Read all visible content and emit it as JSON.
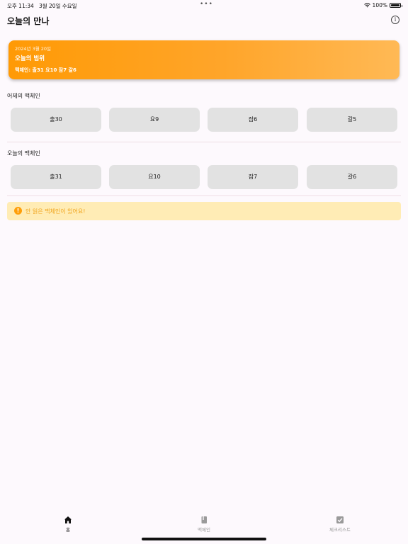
{
  "status_bar": {
    "time": "오후 11:34",
    "date": "3월 20일 수요일",
    "dots": "•••",
    "battery": "100%"
  },
  "nav": {
    "title": "오늘의 만나",
    "info_glyph": "i"
  },
  "hero": {
    "date": "2024년 3월 20일",
    "title": "오늘의 범위",
    "range": "맥체인: 출31 요10 잠7 갈6"
  },
  "yesterday": {
    "label": "어제의 맥체인",
    "chips": [
      "출30",
      "요9",
      "잠6",
      "갈5"
    ]
  },
  "today": {
    "label": "오늘의 맥체인",
    "chips": [
      "출31",
      "요10",
      "잠7",
      "갈6"
    ]
  },
  "alert": {
    "icon_glyph": "!",
    "text": "안 읽은 맥체인이 있어요!",
    "color": "#ff9f0a"
  },
  "tabs": [
    {
      "label": "홈",
      "icon": "house-icon",
      "active": true
    },
    {
      "label": "맥체인",
      "icon": "book-icon",
      "active": false
    },
    {
      "label": "체크리스트",
      "icon": "checkbox-icon",
      "active": false
    }
  ],
  "colors": {
    "accent": "#ff9a05",
    "background": "#fdf9fd",
    "chip": "#e2e2e2",
    "tab_active": "#111111",
    "tab_inactive": "#9a9a9a"
  }
}
